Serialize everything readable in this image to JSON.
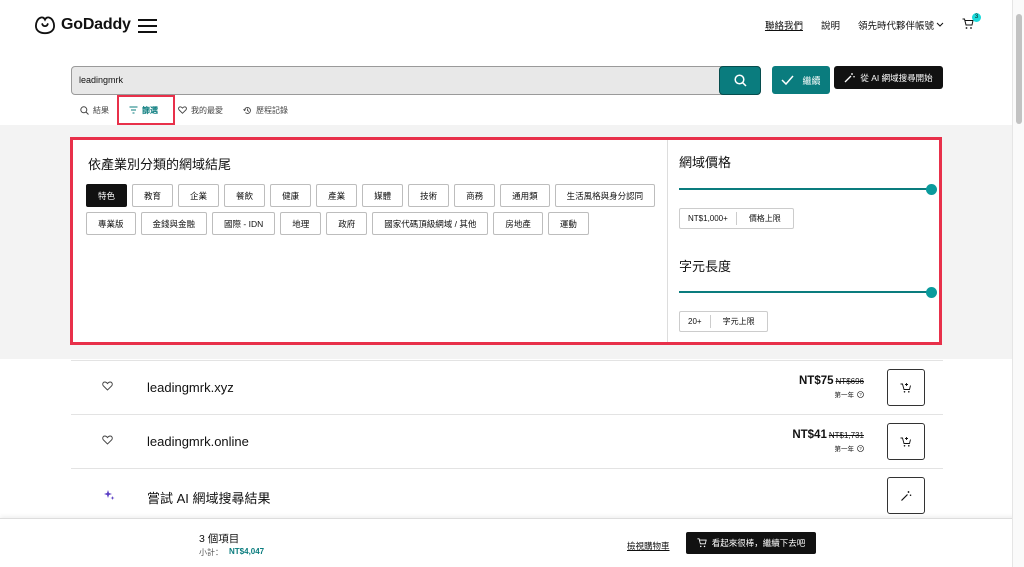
{
  "header": {
    "logo_text": "GoDaddy",
    "contact_label": "聯絡我們",
    "help_label": "說明",
    "account_label": "領先時代夥伴帳號",
    "cart_count": "3"
  },
  "search": {
    "value": "leadingmrk",
    "continue_label": "繼續",
    "ai_label": "從 AI 網域搜尋開始"
  },
  "tabs": [
    {
      "label": "結果"
    },
    {
      "label": "篩選"
    },
    {
      "label": "我的最愛"
    },
    {
      "label": "歷程記錄"
    }
  ],
  "filters": {
    "industry_title": "依產業別分類的網域結尾",
    "categories": [
      "特色",
      "教育",
      "企業",
      "餐飲",
      "健康",
      "產業",
      "媒體",
      "技術",
      "商務",
      "通用類",
      "生活風格與身分認同",
      "專業版",
      "金錢與金融",
      "國際 - IDN",
      "地理",
      "政府",
      "國家代碼頂級網域 / 其他",
      "房地產",
      "運動"
    ],
    "active_category": "特色",
    "price": {
      "title": "網域價格",
      "min_label": "NT$1,000+",
      "max_label": "價格上限",
      "level": 1.0
    },
    "length": {
      "title": "字元長度",
      "min_label": "20+",
      "max_label": "字元上限",
      "level": 1.0
    }
  },
  "results": [
    {
      "domain": "leadingmrk.xyz",
      "price": "NT$75",
      "old_price": "NT$696",
      "term": "第一年"
    },
    {
      "domain": "leadingmrk.online",
      "price": "NT$41",
      "old_price": "NT$1,731",
      "term": "第一年"
    }
  ],
  "ai_row": {
    "label": "嘗試 AI 網域搜尋結果"
  },
  "bottom": {
    "items_label": "3 個項目",
    "subtotal_label": "小計：",
    "subtotal_value": "NT$4,047",
    "view_cart_label": "檢視購物車",
    "cta_label": "看起來很棒，繼續下去吧"
  },
  "colors": {
    "accent": "#0a7c7e",
    "highlight": "#e8304a"
  }
}
